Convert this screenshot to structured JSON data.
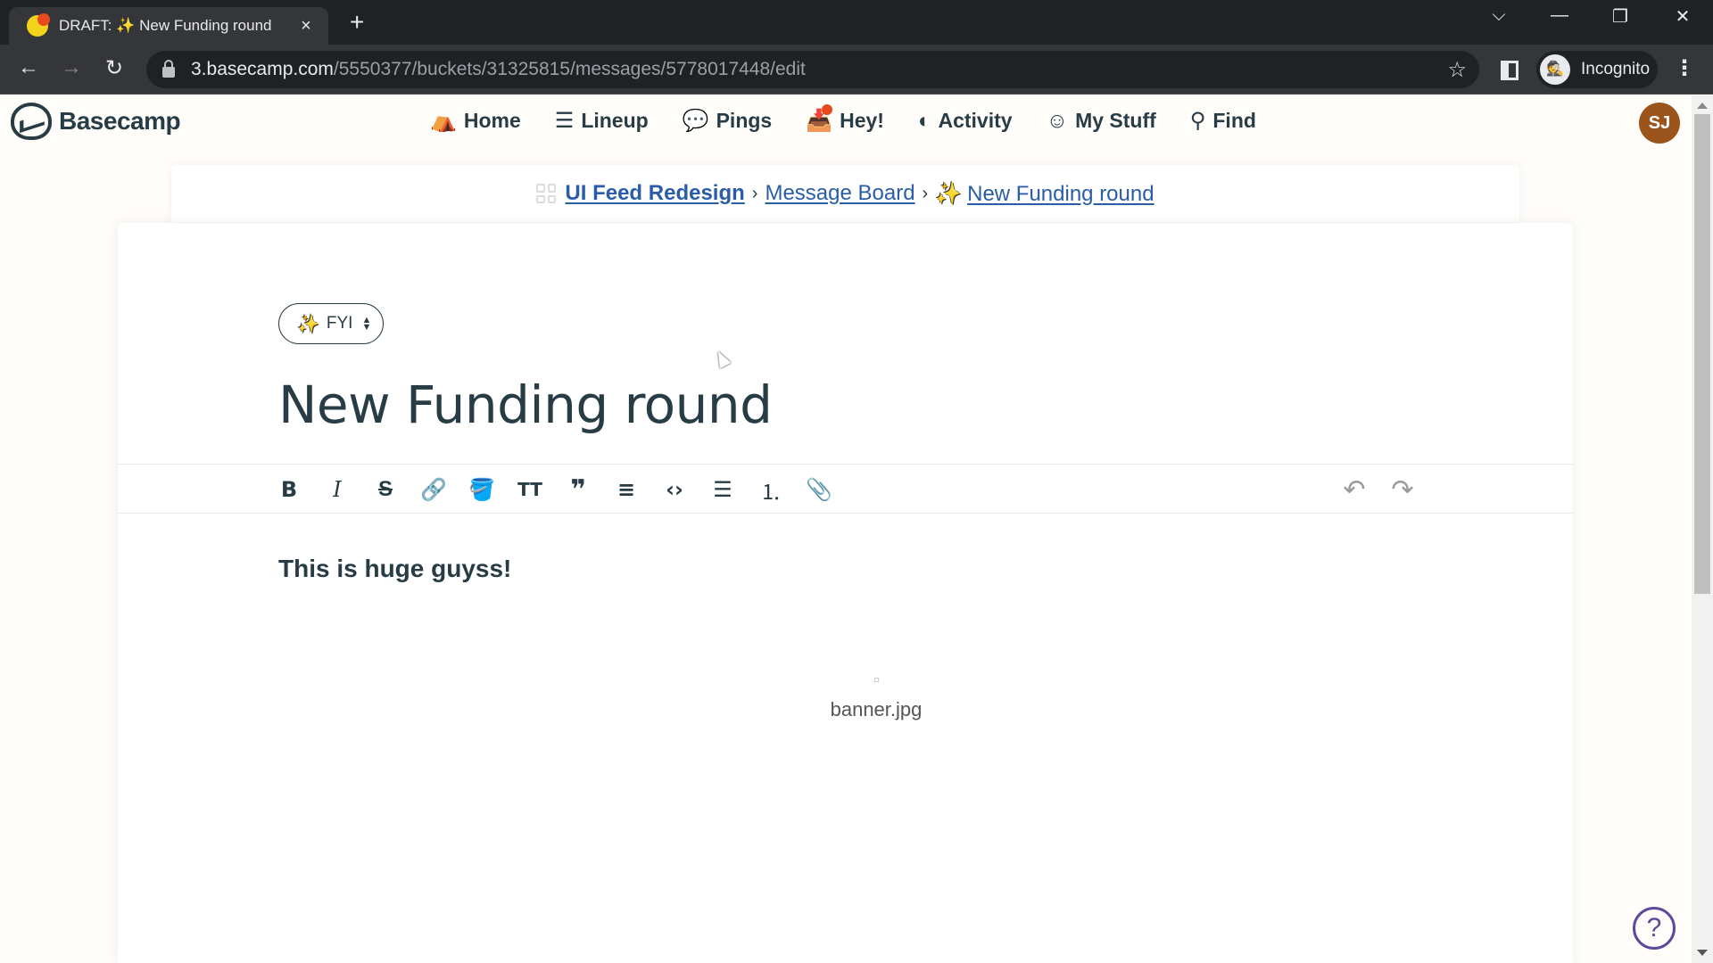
{
  "browser": {
    "tab": {
      "title": "DRAFT: ✨ New Funding round",
      "close_icon": "×"
    },
    "new_tab_icon": "+",
    "window_controls": {
      "tab_search": "⌵",
      "minimize": "—",
      "restore": "❐",
      "close": "✕"
    },
    "nav": {
      "back": "←",
      "forward": "→",
      "reload": "↻"
    },
    "url_host": "3.basecamp.com",
    "url_path": "/5550377/buckets/31325815/messages/5778017448/edit",
    "bookmark_icon": "☆",
    "profile_label": "Incognito",
    "incognito_icon": "🕵",
    "menu_icon": "⋮"
  },
  "app": {
    "brand": "Basecamp",
    "nav": [
      {
        "label": "Home",
        "icon": "⛺"
      },
      {
        "label": "Lineup",
        "icon": "☰"
      },
      {
        "label": "Pings",
        "icon": "💬"
      },
      {
        "label": "Hey!",
        "icon": "📥"
      },
      {
        "label": "Activity",
        "icon": "◐"
      },
      {
        "label": "My Stuff",
        "icon": "☺"
      },
      {
        "label": "Find",
        "icon": "⚲"
      }
    ],
    "user_initials": "SJ",
    "colors": {
      "accent_link": "#2a5ca8",
      "text": "#283c46",
      "avatar": "#9b541c",
      "notification": "#e8491d",
      "help": "#5b4a9b"
    }
  },
  "breadcrumb": {
    "project": "UI Feed Redesign",
    "board": "Message Board",
    "message": "New Funding round",
    "separator": "›",
    "sparkle": "✨"
  },
  "editor": {
    "category": {
      "label": "FYI",
      "icon": "✨",
      "updown_up": "▲",
      "updown_down": "▼"
    },
    "title": "New Funding round",
    "toolbar": {
      "bold": "B",
      "italic": "I",
      "strike": "S",
      "link": "🔗",
      "color": "🪣",
      "heading": "TT",
      "quote": "❞",
      "hr": "≡",
      "code": "‹›",
      "bullets": "☰",
      "numbers": "⒈",
      "attach": "📎",
      "undo": "↶",
      "redo": "↷"
    },
    "body": "This is huge guyss!",
    "attachment": {
      "filename": "banner.jpg"
    }
  },
  "help_icon": "?"
}
